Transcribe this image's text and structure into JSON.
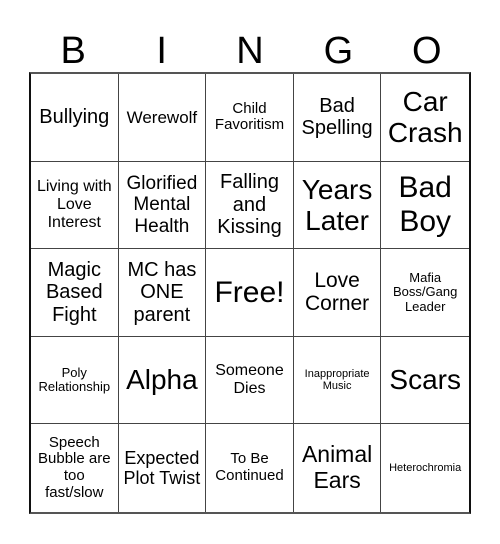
{
  "header": {
    "letters": [
      "B",
      "I",
      "N",
      "G",
      "O"
    ]
  },
  "cells": [
    {
      "text": "Bullying",
      "size": 20
    },
    {
      "text": "Werewolf",
      "size": 17
    },
    {
      "text": "Child Favoritism",
      "size": 15
    },
    {
      "text": "Bad Spelling",
      "size": 20
    },
    {
      "text": "Car Crash",
      "size": 28
    },
    {
      "text": "Living with Love Interest",
      "size": 16
    },
    {
      "text": "Glorified Mental Health",
      "size": 19
    },
    {
      "text": "Falling and Kissing",
      "size": 20
    },
    {
      "text": "Years Later",
      "size": 28
    },
    {
      "text": "Bad Boy",
      "size": 30
    },
    {
      "text": "Magic Based Fight",
      "size": 20
    },
    {
      "text": "MC has ONE parent",
      "size": 20
    },
    {
      "text": "Free!",
      "size": 30
    },
    {
      "text": "Love Corner",
      "size": 21
    },
    {
      "text": "Mafia Boss/Gang Leader",
      "size": 13
    },
    {
      "text": "Poly Relationship",
      "size": 13
    },
    {
      "text": "Alpha",
      "size": 28
    },
    {
      "text": "Someone Dies",
      "size": 16
    },
    {
      "text": "Inappropriate Music",
      "size": 11
    },
    {
      "text": "Scars",
      "size": 28
    },
    {
      "text": "Speech Bubble are too fast/slow",
      "size": 15
    },
    {
      "text": "Expected Plot Twist",
      "size": 18
    },
    {
      "text": "To Be Continued",
      "size": 15
    },
    {
      "text": "Animal Ears",
      "size": 23
    },
    {
      "text": "Heterochromia",
      "size": 11
    }
  ]
}
